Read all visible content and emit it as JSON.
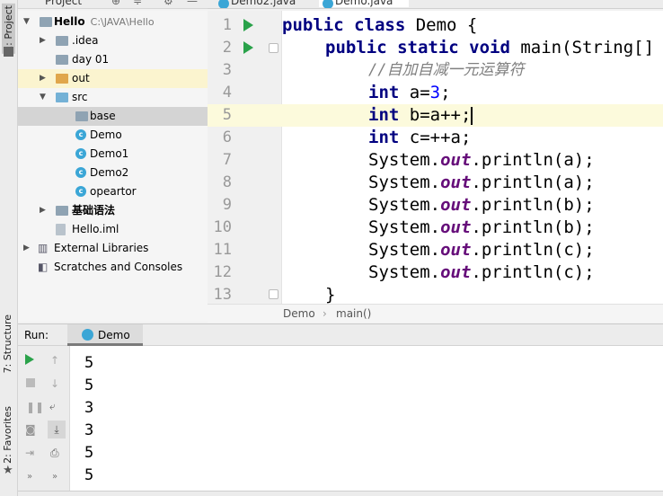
{
  "left_strip": {
    "project_tab": "1: Project",
    "structure_tab": "7: Structure",
    "favorites_tab": "2: Favorites"
  },
  "project_header": {
    "title": "Project"
  },
  "tree": {
    "root_name": "Hello",
    "root_path": "C:\\JAVA\\Hello",
    "items": [
      {
        "label": ".idea"
      },
      {
        "label": "day 01"
      },
      {
        "label": "out"
      },
      {
        "label": "src"
      },
      {
        "label": "base"
      },
      {
        "label": "Demo"
      },
      {
        "label": "Demo1"
      },
      {
        "label": "Demo2"
      },
      {
        "label": "opeartor"
      },
      {
        "label": "基础语法"
      },
      {
        "label": "Hello.iml"
      },
      {
        "label": "External Libraries"
      },
      {
        "label": "Scratches and Consoles"
      }
    ]
  },
  "editor_tabs": [
    {
      "label": "Demo2.java"
    },
    {
      "label": "Demo.java"
    }
  ],
  "editor": {
    "line_numbers": [
      "1",
      "2",
      "3",
      "4",
      "5",
      "6",
      "7",
      "8",
      "9",
      "10",
      "11",
      "12",
      "13"
    ],
    "line1": {
      "kw": "public class",
      "rest": " Demo {"
    },
    "line2": {
      "kw": "public static void",
      "rest": " main(String[]"
    },
    "line3": {
      "comment": "//自加自减一元运算符"
    },
    "line4": {
      "kw": "int",
      "rest": " a=",
      "num": "3",
      "end": ";"
    },
    "line5": {
      "kw": "int",
      "rest": " b=a++;"
    },
    "line6": {
      "kw": "int",
      "rest": " c=++a;"
    },
    "println": [
      {
        "pre": "System.",
        "fld": "out",
        "post": ".println(a);"
      },
      {
        "pre": "System.",
        "fld": "out",
        "post": ".println(a);"
      },
      {
        "pre": "System.",
        "fld": "out",
        "post": ".println(b);"
      },
      {
        "pre": "System.",
        "fld": "out",
        "post": ".println(b);"
      },
      {
        "pre": "System.",
        "fld": "out",
        "post": ".println(c);"
      },
      {
        "pre": "System.",
        "fld": "out",
        "post": ".println(c);"
      }
    ],
    "line13": "}"
  },
  "breadcrumb": {
    "class_name": "Demo",
    "method_name": "main()"
  },
  "run": {
    "label": "Run:",
    "tab_label": "Demo",
    "output": [
      "5",
      "5",
      "3",
      "3",
      "5",
      "5"
    ]
  },
  "colors": {
    "keyword": "#000080",
    "comment": "#808080",
    "number": "#0000ff",
    "field": "#660e7a",
    "run_green": "#2aa24a"
  }
}
